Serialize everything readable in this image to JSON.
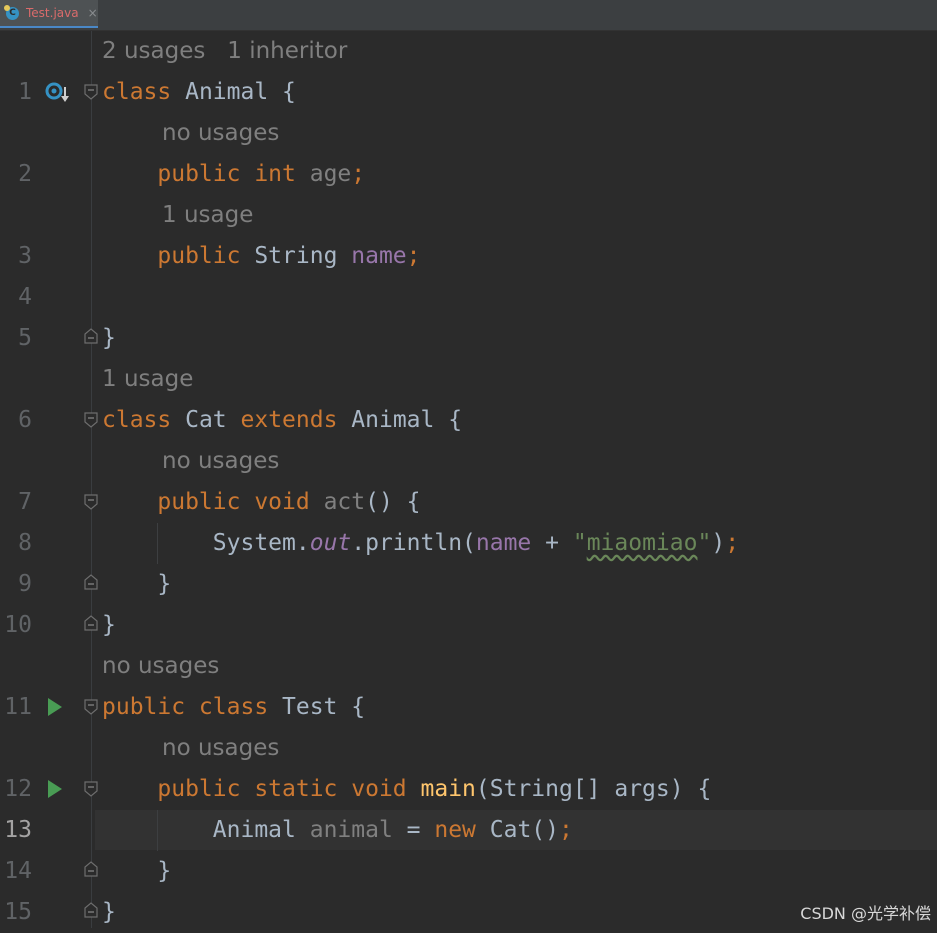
{
  "tab": {
    "label": "Test.java",
    "close": "×",
    "icon": "java-class-icon"
  },
  "hints": {
    "h0": "2 usages   1 inheritor",
    "h1": "no usages",
    "h2": "1 usage",
    "h3": "1 usage",
    "h4": "no usages",
    "h5": "no usages",
    "h6": "no usages"
  },
  "lines": [
    {
      "n": "1",
      "tokens": [
        [
          "kw",
          "class"
        ],
        [
          "p",
          " Animal {"
        ]
      ]
    },
    {
      "n": "2",
      "tokens": [
        [
          "p",
          "    "
        ],
        [
          "kw",
          "public int"
        ],
        [
          "p",
          " "
        ],
        [
          "unused",
          "age"
        ],
        [
          "kw",
          ";"
        ]
      ]
    },
    {
      "n": "3",
      "tokens": [
        [
          "p",
          "    "
        ],
        [
          "kw",
          "public"
        ],
        [
          "p",
          " String "
        ],
        [
          "fld",
          "name"
        ],
        [
          "kw",
          ";"
        ]
      ]
    },
    {
      "n": "4",
      "tokens": []
    },
    {
      "n": "5",
      "tokens": [
        [
          "p",
          "}"
        ]
      ]
    },
    {
      "n": "6",
      "tokens": [
        [
          "kw",
          "class"
        ],
        [
          "p",
          " Cat "
        ],
        [
          "kw",
          "extends"
        ],
        [
          "p",
          " Animal {"
        ]
      ]
    },
    {
      "n": "7",
      "tokens": [
        [
          "p",
          "    "
        ],
        [
          "kw",
          "public void"
        ],
        [
          "p",
          " "
        ],
        [
          "unused",
          "act"
        ],
        [
          "p",
          "() {"
        ]
      ]
    },
    {
      "n": "8",
      "tokens": [
        [
          "p",
          "        System."
        ],
        [
          "sfld",
          "out"
        ],
        [
          "p",
          ".println("
        ],
        [
          "fld",
          "name"
        ],
        [
          "p",
          " + "
        ],
        [
          "str",
          "\""
        ],
        [
          "strsq",
          "miaomiao"
        ],
        [
          "str",
          "\""
        ],
        [
          "p",
          ")"
        ],
        [
          "kw",
          ";"
        ]
      ]
    },
    {
      "n": "9",
      "tokens": [
        [
          "p",
          "    }"
        ]
      ]
    },
    {
      "n": "10",
      "tokens": [
        [
          "p",
          "}"
        ]
      ]
    },
    {
      "n": "11",
      "tokens": [
        [
          "kw",
          "public class"
        ],
        [
          "p",
          " Test {"
        ]
      ]
    },
    {
      "n": "12",
      "tokens": [
        [
          "p",
          "    "
        ],
        [
          "kw",
          "public static void"
        ],
        [
          "p",
          " "
        ],
        [
          "fn",
          "main"
        ],
        [
          "p",
          "(String[] args) {"
        ]
      ]
    },
    {
      "n": "13",
      "tokens": [
        [
          "p",
          "        Animal "
        ],
        [
          "unused",
          "animal"
        ],
        [
          "p",
          " = "
        ],
        [
          "kw",
          "new"
        ],
        [
          "p",
          " Cat()"
        ],
        [
          "kw",
          ";"
        ]
      ]
    },
    {
      "n": "14",
      "tokens": [
        [
          "p",
          "    }"
        ]
      ]
    },
    {
      "n": "15",
      "tokens": [
        [
          "p",
          "}"
        ]
      ]
    }
  ],
  "current_line": "13",
  "gutter": {
    "line1_icon": "implemented-override-icon",
    "line11_icon": "run-icon",
    "line12_icon": "run-icon"
  },
  "colors": {
    "keyword": "#cc7832",
    "field": "#9876aa",
    "string": "#6a8759",
    "method": "#ffc66d",
    "text": "#a9b7c6",
    "background": "#2b2b2b"
  },
  "watermark": "CSDN @光学补偿"
}
